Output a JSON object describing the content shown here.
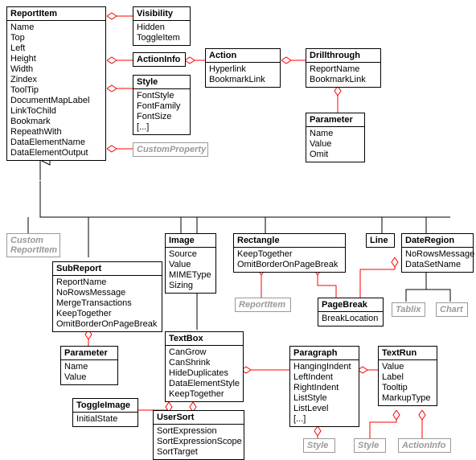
{
  "ReportItem": {
    "title": "ReportItem",
    "attrs": [
      "Name",
      "Top",
      "Left",
      "Height",
      "Width",
      "Zindex",
      "ToolTip",
      "DocumentMapLabel",
      "LinkToChild",
      "Bookmark",
      "RepeathWith",
      "DataElementName",
      "DataElementOutput"
    ]
  },
  "Visibility": {
    "title": "Visibility",
    "attrs": [
      "Hidden",
      "ToggleItem"
    ]
  },
  "ActionInfo": {
    "title": "ActionInfo"
  },
  "Style": {
    "title": "Style",
    "attrs": [
      "FontStyle",
      "FontFamily",
      "FontSize",
      "[...]"
    ]
  },
  "CustomProperty": {
    "title": "CustomProperty"
  },
  "Action": {
    "title": "Action",
    "attrs": [
      "Hyperlink",
      "BookmarkLink"
    ]
  },
  "Drillthrough": {
    "title": "Drillthrough",
    "attrs": [
      "ReportName",
      "BookmarkLink"
    ]
  },
  "Parameter1": {
    "title": "Parameter",
    "attrs": [
      "Name",
      "Value",
      "Omit"
    ]
  },
  "CustomReportItem": {
    "title": "Custom\nReportItem"
  },
  "SubReport": {
    "title": "SubReport",
    "attrs": [
      "ReportName",
      "NoRowsMessage",
      "MergeTransactions",
      "KeepTogether",
      "OmitBorderOnPageBreak"
    ]
  },
  "Parameter2": {
    "title": "Parameter",
    "attrs": [
      "Name",
      "Value"
    ]
  },
  "Image": {
    "title": "Image",
    "attrs": [
      "Source",
      "Value",
      "MIMEType",
      "Sizing"
    ]
  },
  "Rectangle": {
    "title": "Rectangle",
    "attrs": [
      "KeepTogether",
      "OmitBorderOnPageBreak"
    ]
  },
  "ReportItemRef": {
    "title": "ReportItem"
  },
  "Line": {
    "title": "Line"
  },
  "DateRegion": {
    "title": "DateRegion",
    "attrs": [
      "NoRowsMessage",
      "DataSetName"
    ]
  },
  "Tablix": {
    "title": "Tablix"
  },
  "Chart": {
    "title": "Chart"
  },
  "PageBreak": {
    "title": "PageBreak",
    "attrs": [
      "BreakLocation"
    ]
  },
  "TextBox": {
    "title": "TextBox",
    "attrs": [
      "CanGrow",
      "CanShrink",
      "HideDuplicates",
      "DataElementStyle",
      "KeepTogether"
    ]
  },
  "ToggleImage": {
    "title": "ToggleImage",
    "attrs": [
      "InitialState"
    ]
  },
  "UserSort": {
    "title": "UserSort",
    "attrs": [
      "SortExpression",
      "SortExpressionScope",
      "SortTarget"
    ]
  },
  "Paragraph": {
    "title": "Paragraph",
    "attrs": [
      "HangingIndent",
      "LeftIndent",
      "RightIndent",
      "ListStyle",
      "ListLevel",
      "[...]"
    ]
  },
  "TextRun": {
    "title": "TextRun",
    "attrs": [
      "Value",
      "Label",
      "Tooltip",
      "MarkupType"
    ]
  },
  "StyleRef1": {
    "title": "Style"
  },
  "StyleRef2": {
    "title": "Style"
  },
  "ActionInfoRef": {
    "title": "ActionInfo"
  }
}
